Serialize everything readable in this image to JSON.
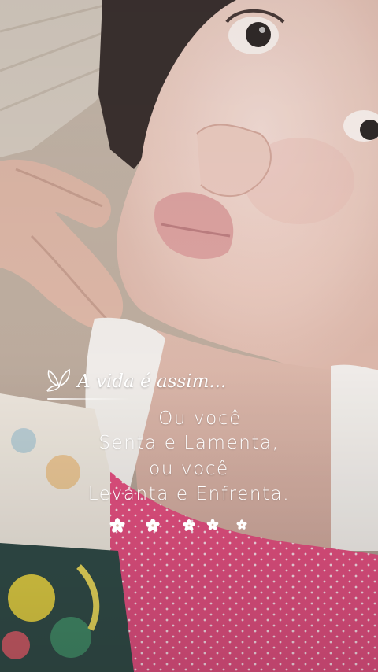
{
  "overlay": {
    "title": "A vida é assim...",
    "lines": [
      "Ou você",
      "Senta e Lamenta,",
      "ou você",
      "Levanta e Enfrenta."
    ]
  },
  "colors": {
    "text": "#ffffff",
    "skin": "#e8c9bd",
    "shirt_pink": "#e0457a",
    "shirt_white": "#eeeae6"
  },
  "icons": [
    "butterfly-icon",
    "flower-icon"
  ]
}
